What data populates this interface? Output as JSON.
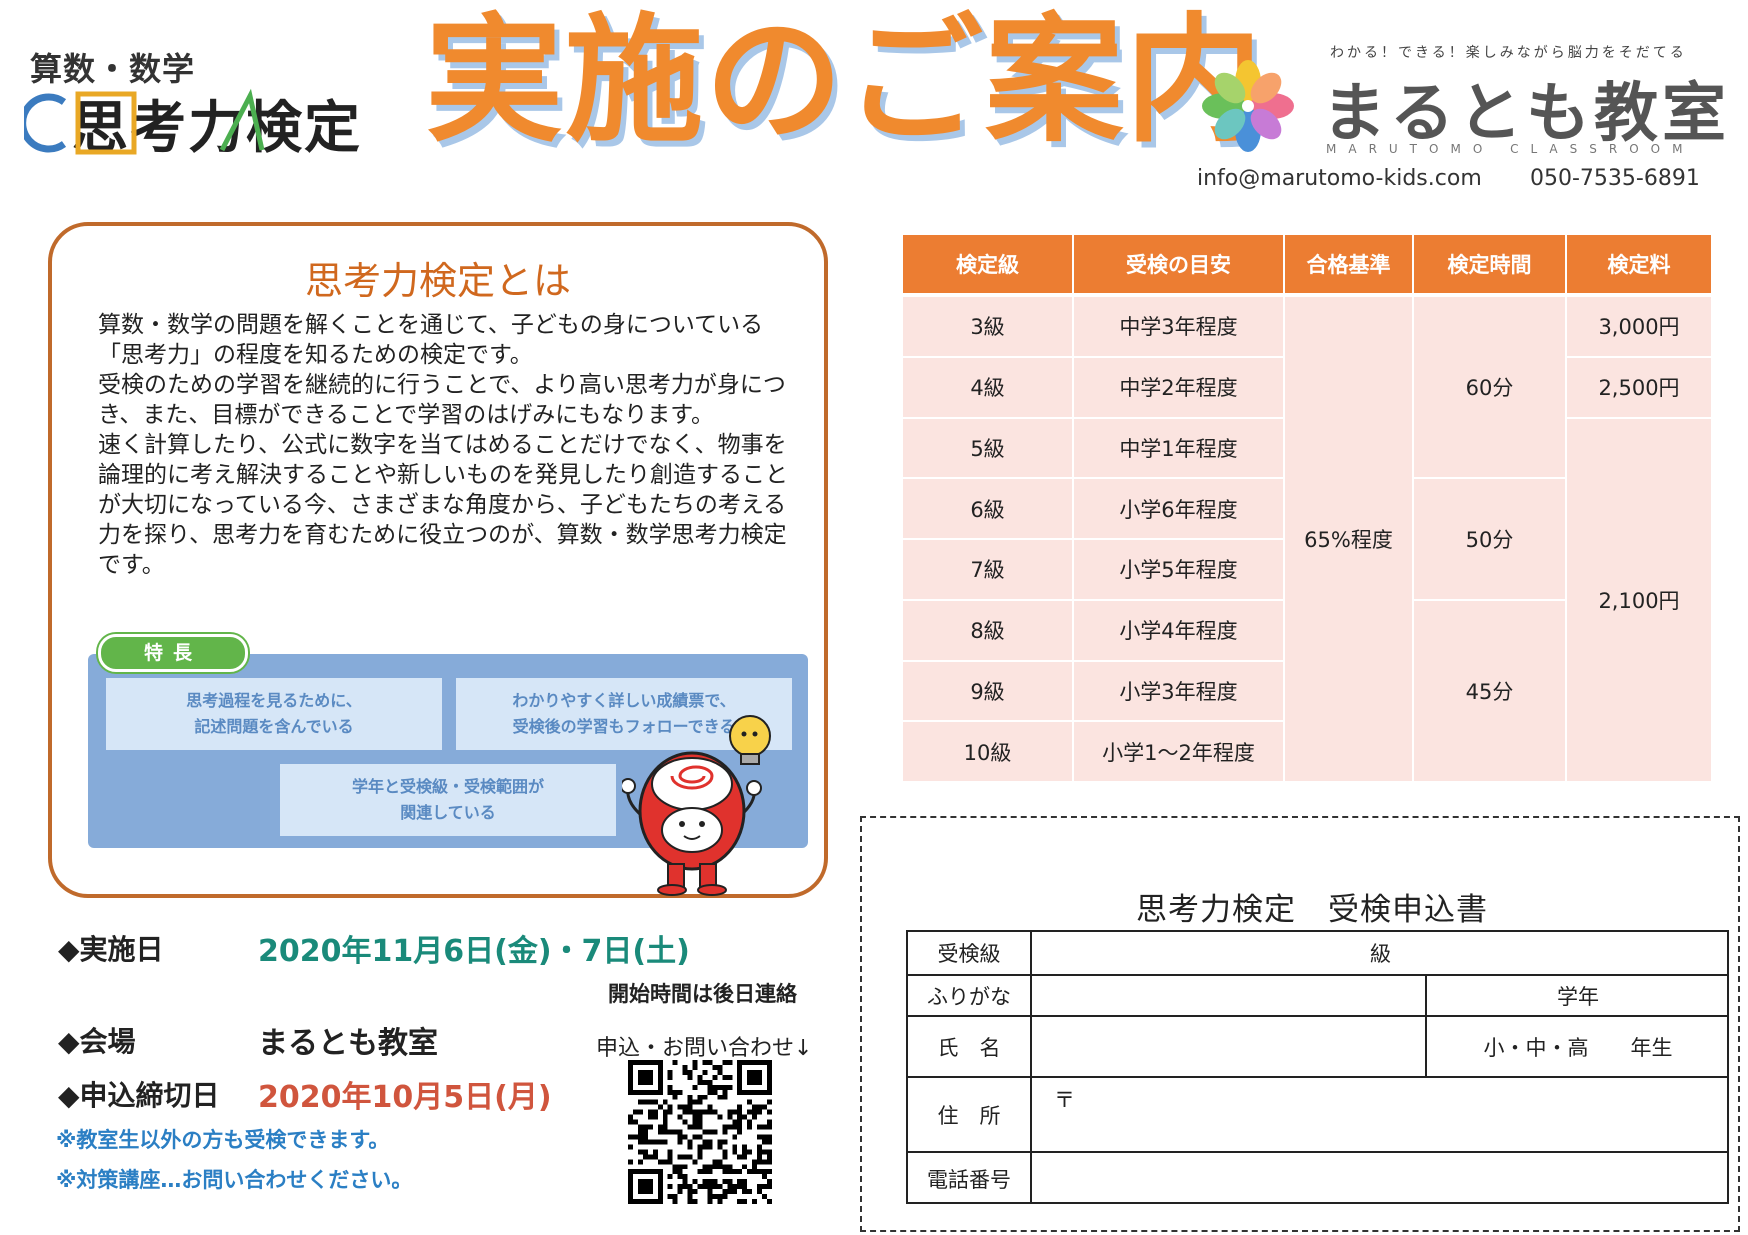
{
  "header": {
    "logo_small": "算数・数学",
    "logo_main": "思考力検定",
    "title": "実施のご案内",
    "classroom_tagline": "わかる！できる！楽しみながら脳力をそだてる",
    "classroom_name": "まるとも教室",
    "classroom_en": "MARUTOMO CLASSROOM",
    "email": "info@marutomo-kids.com",
    "phone": "050-7535-6891"
  },
  "about": {
    "title": "思考力検定とは",
    "paragraphs": [
      "算数・数学の問題を解くことを通じて、子どもの身についている「思考力」の程度を知るための検定です。",
      "受検のための学習を継続的に行うことで、より高い思考力が身につき、また、目標ができることで学習のはげみにもなります。",
      "速く計算したり、公式に数字を当てはめることだけでなく、物事を論理的に考え解決することや新しいものを発見したり創造することが大切になっている今、さまざまな角度から、子どもたちの考える力を探り、思考力を育むために役立つのが、算数・数学思考力検定です。"
    ],
    "features_tag": "特長",
    "features": [
      {
        "line1": "思考過程を見るために、",
        "line2": "記述問題を含んでいる"
      },
      {
        "line1": "わかりやすく詳しい成績票で、",
        "line2": "受検後の学習もフォローできる"
      },
      {
        "line1": "学年と受検級・受検範囲が",
        "line2": "関連している"
      }
    ]
  },
  "info": {
    "date_label": "◆実施日",
    "date_value": "2020年11月6日(金)・7日(土)",
    "start_note": "開始時間は後日連絡",
    "venue_label": "◆会場",
    "venue_value": "まるとも教室",
    "apply_note": "申込・お問い合わせ↓",
    "deadline_label": "◆申込締切日",
    "deadline_value": "2020年10月5日(月)",
    "note_1": "※教室生以外の方も受検できます。",
    "note_2": "※対策講座…お問い合わせください。"
  },
  "exam_table": {
    "headers": [
      "検定級",
      "受検の目安",
      "合格基準",
      "検定時間",
      "検定料"
    ],
    "rows": [
      {
        "grade": "3級",
        "level": "中学3年程度"
      },
      {
        "grade": "4級",
        "level": "中学2年程度"
      },
      {
        "grade": "5級",
        "level": "中学1年程度"
      },
      {
        "grade": "6級",
        "level": "小学6年程度"
      },
      {
        "grade": "7級",
        "level": "小学5年程度"
      },
      {
        "grade": "8級",
        "level": "小学4年程度"
      },
      {
        "grade": "9級",
        "level": "小学3年程度"
      },
      {
        "grade": "10級",
        "level": "小学1～2年程度"
      }
    ],
    "pass_standard": "65%程度",
    "times": [
      "60分",
      "50分",
      "45分"
    ],
    "fees": [
      "3,000円",
      "2,500円",
      "2,100円"
    ]
  },
  "form": {
    "title": "思考力検定　受検申込書",
    "grade_label": "受検級",
    "grade_suffix": "級",
    "furigana_label": "ふりがな",
    "school_year_label": "学年",
    "name_label": "氏　名",
    "school_year_value": "小・中・高　　年生",
    "address_label": "住　所",
    "postal_mark": "〒",
    "phone_label": "電話番号"
  }
}
